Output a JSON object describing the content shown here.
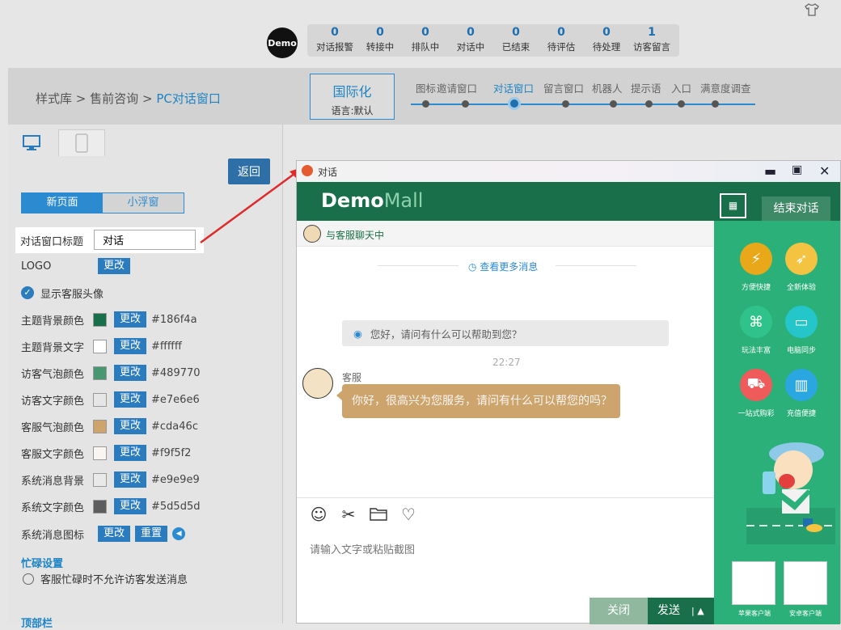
{
  "topbar": {
    "logo": "Demo",
    "stats": [
      {
        "num": "0",
        "label": "对话报警"
      },
      {
        "num": "0",
        "label": "转接中"
      },
      {
        "num": "0",
        "label": "排队中"
      },
      {
        "num": "0",
        "label": "对话中"
      },
      {
        "num": "0",
        "label": "已结束"
      },
      {
        "num": "0",
        "label": "待评估"
      },
      {
        "num": "0",
        "label": "待处理"
      },
      {
        "num": "1",
        "label": "访客留言"
      }
    ]
  },
  "breadcrumb": {
    "a": "样式库",
    "sep": ">",
    "b": "售前咨询",
    "c": "PC对话窗口"
  },
  "intl": {
    "title": "国际化",
    "sub": "语言:默认"
  },
  "steps": [
    "图标",
    "邀请窗口",
    "对话窗口",
    "留言窗口",
    "机器人",
    "提示语",
    "入口",
    "满意度调查"
  ],
  "left": {
    "back": "返回",
    "seg_new": "新页面",
    "seg_float": "小浮窗",
    "title_label": "对话窗口标题",
    "title_value": "对话",
    "logo_label": "LOGO",
    "change": "更改",
    "show_avatar": "显示客服头像",
    "colors": [
      {
        "label": "主题背景颜色",
        "hex": "#186f4a"
      },
      {
        "label": "主题背景文字",
        "hex": "#ffffff"
      },
      {
        "label": "访客气泡颜色",
        "hex": "#489770"
      },
      {
        "label": "访客文字颜色",
        "hex": "#e7e6e6"
      },
      {
        "label": "客服气泡颜色",
        "hex": "#cda46c"
      },
      {
        "label": "客服文字颜色",
        "hex": "#f9f5f2"
      },
      {
        "label": "系统消息背景",
        "hex": "#e9e9e9"
      },
      {
        "label": "系统文字颜色",
        "hex": "#5d5d5d"
      }
    ],
    "sys_icon_label": "系统消息图标",
    "reset": "重置",
    "busy_title": "忙碌设置",
    "busy_option": "客服忙碌时不允许访客发送消息",
    "top_section": "顶部栏"
  },
  "chat": {
    "window_title": "对话",
    "brand_demo": "Demo",
    "brand_mall": "Mall",
    "end": "结束对话",
    "head": "与客服聊天中",
    "more": "查看更多消息",
    "sys_msg": "您好，请问有什么可以帮助到您？",
    "time": "22:27",
    "agent_name": "客服",
    "agent_msg": "你好，很高兴为您服务，请问有什么可以帮您的吗？",
    "input_placeholder": "请输入文字或粘贴截图",
    "close": "关闭",
    "send": "发送"
  },
  "side": {
    "features": [
      {
        "label": "方便快捷",
        "icon": "lightning-icon",
        "color": "#e8a81a"
      },
      {
        "label": "全新体验",
        "icon": "rocket-icon",
        "color": "#f5c342"
      },
      {
        "label": "玩法丰富",
        "icon": "gamepad-icon",
        "color": "#2fc28a"
      },
      {
        "label": "电脑同步",
        "icon": "monitor-icon",
        "color": "#25c6c9"
      },
      {
        "label": "一站式购彩",
        "icon": "cart-icon",
        "color": "#ef5b5b"
      },
      {
        "label": "充值便捷",
        "icon": "card-icon",
        "color": "#2aa6e0"
      }
    ],
    "qr_ios": "苹果客户端",
    "qr_android": "安卓客户端"
  }
}
